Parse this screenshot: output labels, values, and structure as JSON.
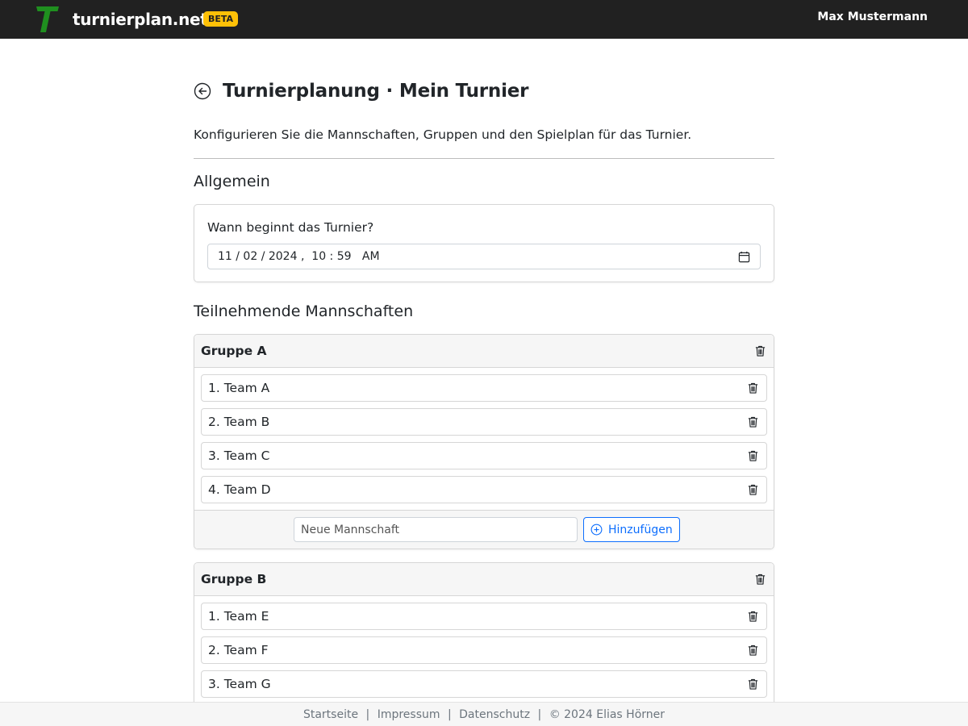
{
  "navbar": {
    "logo_letter": "T",
    "brand": "turnierplan.net",
    "badge": "BETA",
    "user": "Max Mustermann",
    "logo_color": "#1f8f1f"
  },
  "page": {
    "title": "Turnierplanung · Mein Turnier",
    "subtitle": "Konfigurieren Sie die Mannschaften, Gruppen und den Spielplan für das Turnier."
  },
  "general": {
    "section_title": "Allgemein",
    "start_label": "Wann beginnt das Turnier?",
    "start_value": "11 / 02 / 2024 ,  10 : 59   AM"
  },
  "teams_section": {
    "section_title": "Teilnehmende Mannschaften",
    "new_team_placeholder": "Neue Mannschaft",
    "add_label": "Hinzufügen",
    "groups": [
      {
        "name": "Gruppe A",
        "teams": [
          "1. Team A",
          "2. Team B",
          "3. Team C",
          "4. Team D"
        ]
      },
      {
        "name": "Gruppe B",
        "teams": [
          "1. Team E",
          "2. Team F",
          "3. Team G"
        ]
      }
    ]
  },
  "footer": {
    "links": [
      "Startseite",
      "Impressum",
      "Datenschutz"
    ],
    "copyright": "© 2024 Elias Hörner"
  }
}
